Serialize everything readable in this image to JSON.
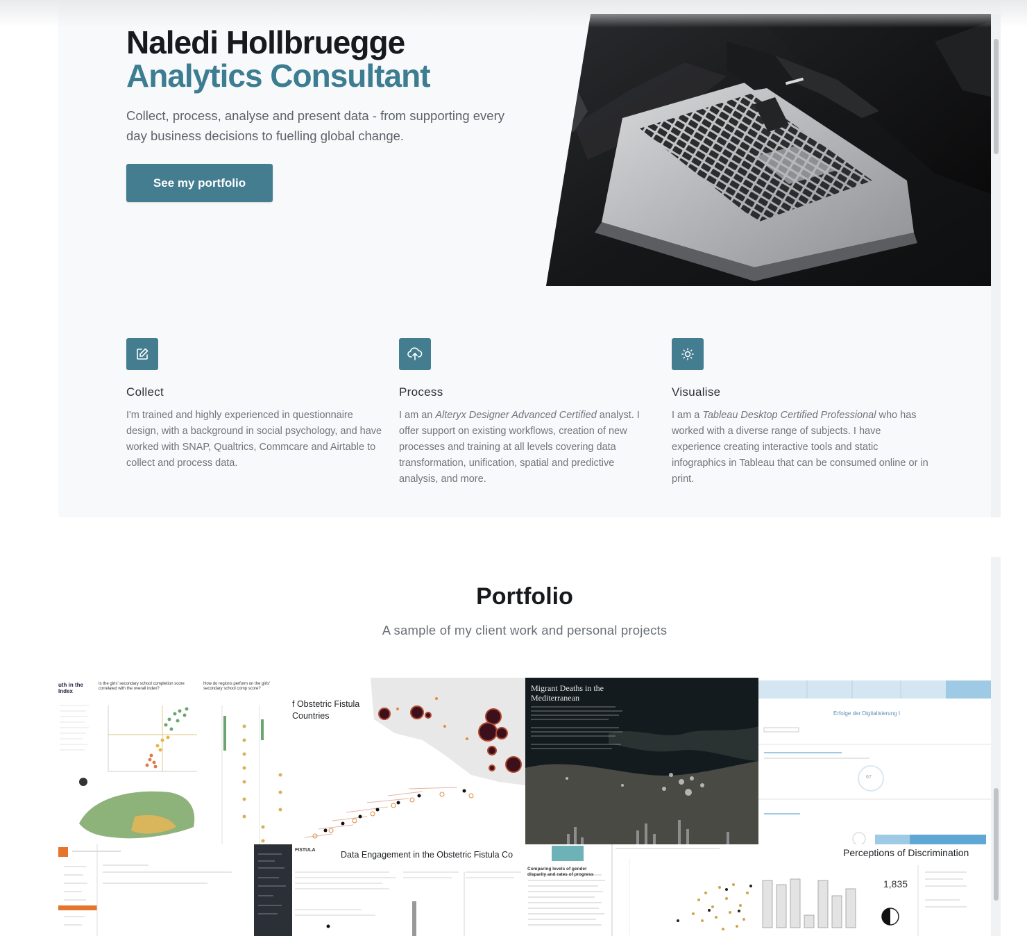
{
  "hero": {
    "name": "Naledi Hollbruegge",
    "role": "Analytics Consultant",
    "tagline": "Collect, process, analyse and present data - from supporting every day business decisions to fuelling global change.",
    "cta_label": "See my portfolio"
  },
  "features": [
    {
      "icon": "pencil-square-icon",
      "title": "Collect",
      "desc": "I'm trained and highly experienced in questionnaire design, with a background in social psychology, and have worked with SNAP, Qualtrics, Commcare and Airtable to collect and process data."
    },
    {
      "icon": "cloud-upload-icon",
      "title": "Process",
      "desc_before": "I am an ",
      "desc_em": "Alteryx Designer Advanced Certified",
      "desc_after": " analyst. I offer support on existing workflows, creation of new processes and training at all levels covering data transformation, unification, spatial and predictive analysis, and more."
    },
    {
      "icon": "lightbulb-icon",
      "title": "Visualise",
      "desc_before": "I am a ",
      "desc_em": "Tableau Desktop Certified Professional",
      "desc_after": " who has worked with a diverse range of subjects. I have experience creating interactive tools and static infographics in Tableau that can be consumed online or in print."
    }
  ],
  "portfolio": {
    "title": "Portfolio",
    "subtitle": "A sample of my client work and personal projects",
    "thumbs": {
      "youth_index": "uth in the\nIndex",
      "girls_q1": "Is the girls' secondary school completion score correlated with the overall index?",
      "girls_q2": "How do regions perform on the girls' secondary school comp score?",
      "fistula_countries": "f Obstetric Fistula\nCountries",
      "migrant": "Migrant Deaths in the\nMediterranean",
      "german_title": "Erfolge der Digitalisierung I",
      "gauge_value": "67",
      "perceptions": "Perceptions of Discrimination",
      "perceptions_value": "1,835",
      "fistula_engagement": "Data Engagement in the Obstetric Fistula Co",
      "fistula_logo": "FISTULA",
      "gender_title": "Comparing levels of gender disparity and rates of progress"
    }
  }
}
